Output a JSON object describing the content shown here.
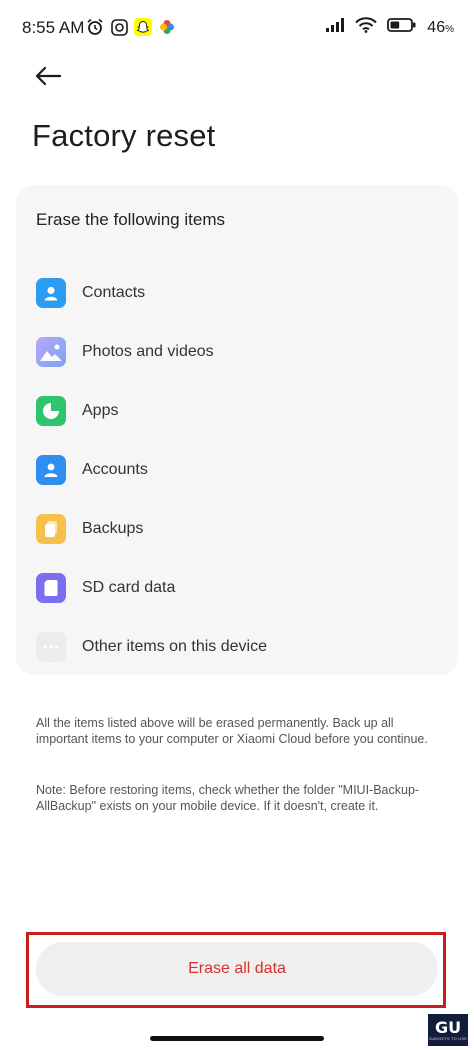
{
  "status_bar": {
    "time": "8:55 AM",
    "battery_percent": "46",
    "battery_symbol": "%",
    "battery_level": 0.46,
    "icons": [
      "alarm-icon",
      "app-notification-icon",
      "snapchat-icon",
      "photos-icon",
      "signal-icon",
      "wifi-icon",
      "battery-icon"
    ]
  },
  "header": {
    "back_icon": "arrow-left-icon",
    "title": "Factory reset"
  },
  "card": {
    "heading": "Erase the following items",
    "items": [
      {
        "label": "Contacts",
        "icon": "contacts-icon",
        "color": "#2b9cf2"
      },
      {
        "label": "Photos and videos",
        "icon": "gallery-icon",
        "color": "#8ea6f5"
      },
      {
        "label": "Apps",
        "icon": "apps-icon",
        "color": "#2ec56c"
      },
      {
        "label": "Accounts",
        "icon": "accounts-icon",
        "color": "#2f8ff0"
      },
      {
        "label": "Backups",
        "icon": "backups-icon",
        "color": "#f6c04a"
      },
      {
        "label": "SD card data",
        "icon": "sd-card-icon",
        "color": "#7a6ff0"
      },
      {
        "label": "Other items on this device",
        "icon": "more-icon",
        "color": "#ececec"
      }
    ]
  },
  "notes": {
    "warning": "All the items listed above will be erased permanently. Back up all important items to your computer or Xiaomi Cloud before you continue.",
    "restore_note": "Note: Before restoring items, check whether the folder \"MIUI-Backup-AllBackup\" exists on your mobile device. If it doesn't, create it."
  },
  "action": {
    "erase_label": "Erase all data",
    "accent_color": "#d9302a",
    "highlight_color": "#c81e1e"
  },
  "watermark": {
    "logo": "GU",
    "tagline": "GADGETS TO USE"
  }
}
